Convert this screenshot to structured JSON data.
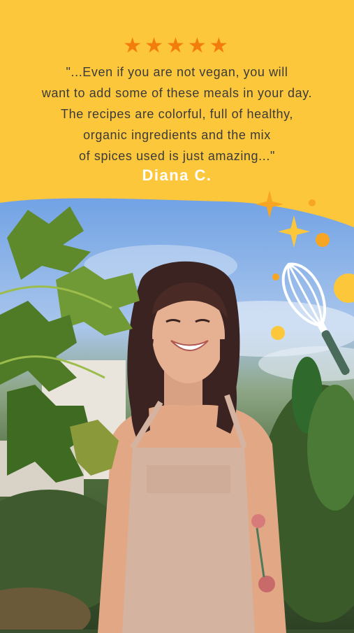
{
  "review": {
    "rating": 5,
    "stars": "★★★★★",
    "quote_lines": [
      "\"...Even if you are not vegan, you will",
      "want to add some of these meals in your day.",
      "The recipes are colorful, full of healthy,",
      "organic ingredients and the mix",
      "of spices used is just amazing...\""
    ],
    "author": "Diana C."
  },
  "colors": {
    "banner": "#fdc73b",
    "star": "#f27d0c",
    "quote_text": "#3b3b3b",
    "author_text": "#ffffff",
    "accent_dot": "#f6a623"
  },
  "decorations": [
    "sparkle-star-icon",
    "whisk-icon",
    "dot"
  ]
}
